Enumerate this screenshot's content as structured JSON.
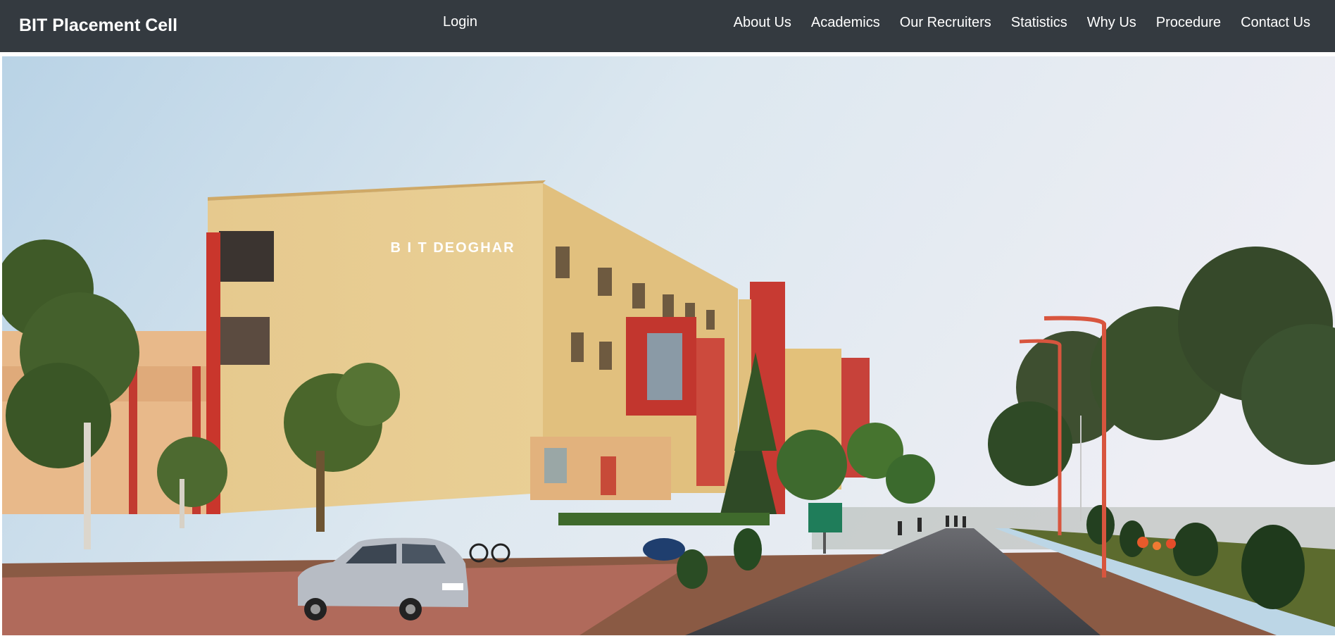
{
  "navbar": {
    "brand": "BIT Placement Cell",
    "login": "Login",
    "links": [
      {
        "label": "About Us"
      },
      {
        "label": "Academics"
      },
      {
        "label": "Our Recruiters"
      },
      {
        "label": "Statistics"
      },
      {
        "label": "Why Us"
      },
      {
        "label": "Procedure"
      },
      {
        "label": "Contact Us"
      }
    ]
  },
  "hero": {
    "building_sign": "B I T DEOGHAR"
  },
  "colors": {
    "navbar_bg": "#343a40",
    "nav_text": "#ffffff"
  }
}
